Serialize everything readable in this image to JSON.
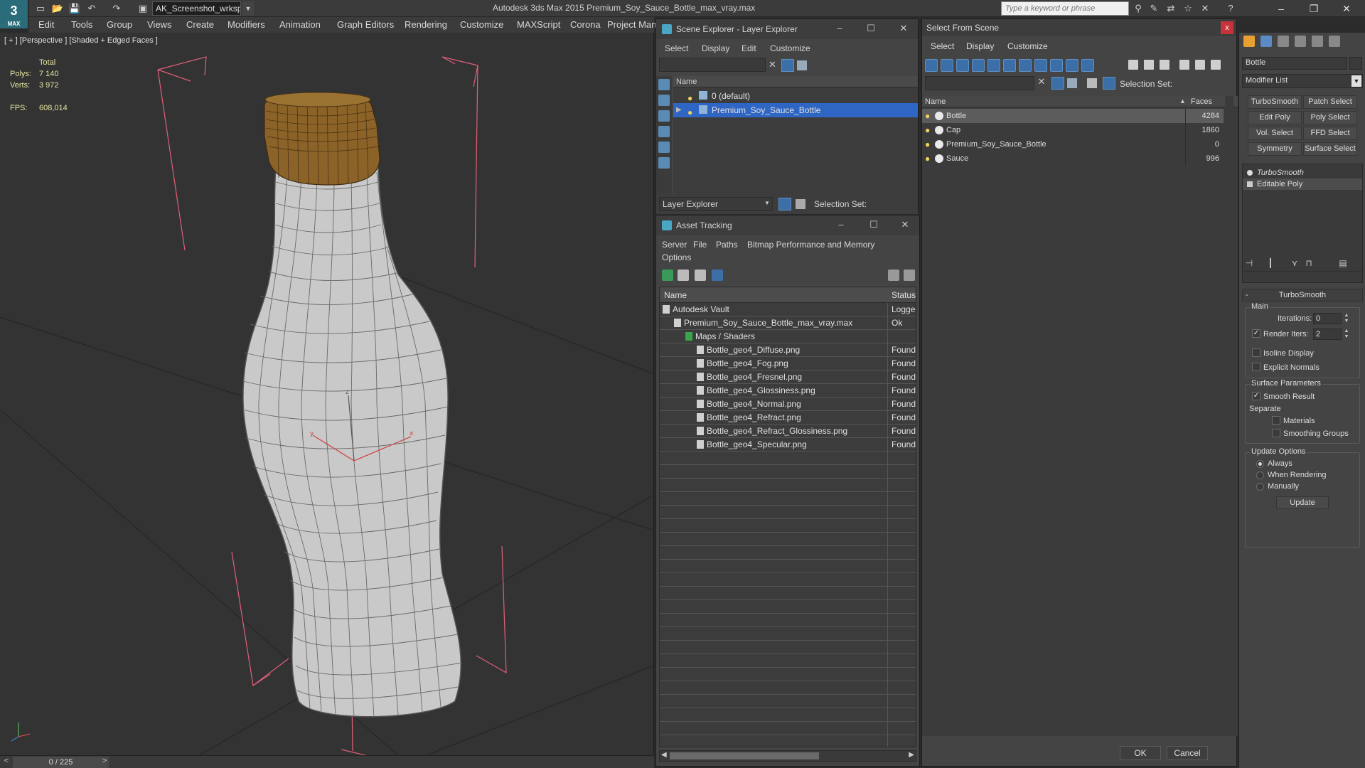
{
  "app": {
    "logo": "MAX",
    "title": "Autodesk 3ds Max  2015     Premium_Soy_Sauce_Bottle_max_vray.max",
    "workspace": "AK_Screenshot_wrksp",
    "search_placeholder": "Type a keyword or phrase",
    "quick_access_icons": [
      "new-file-icon",
      "open-file-icon",
      "save-icon",
      "undo-icon",
      "redo-icon",
      "project-folder-icon"
    ],
    "info_icons": [
      "binoculars-icon",
      "tools-icon",
      "exchange-icon",
      "star-icon",
      "close-x-icon",
      "help-icon"
    ]
  },
  "menu": [
    "Edit",
    "Tools",
    "Group",
    "Views",
    "Create",
    "Modifiers",
    "Animation",
    "Graph Editors",
    "Rendering",
    "Customize",
    "MAXScript",
    "Corona",
    "Project Man"
  ],
  "viewport": {
    "label": "[ + ] [Perspective ] [Shaded + Edged Faces ]",
    "stats": {
      "total_label": "Total",
      "polys_label": "Polys:",
      "polys_value": "7 140",
      "verts_label": "Verts:",
      "verts_value": "3 972",
      "fps_label": "FPS:",
      "fps_value": "608,014"
    },
    "gizmo_labels": {
      "z": "z",
      "y": "y",
      "x": "x"
    }
  },
  "timeline": {
    "position": "0 / 225",
    "prev": "<",
    "next": ">"
  },
  "scene_explorer": {
    "title": "Scene Explorer - Layer Explorer",
    "menus": [
      "Select",
      "Display",
      "Edit",
      "Customize"
    ],
    "column": "Name",
    "layers": [
      {
        "name": "0 (default)",
        "selected": false,
        "expandable": false
      },
      {
        "name": "Premium_Soy_Sauce_Bottle",
        "selected": true,
        "expandable": true
      }
    ],
    "mode": "Layer Explorer",
    "selection_set_label": "Selection Set:"
  },
  "asset_tracking": {
    "title": "Asset Tracking",
    "menus": [
      "Server",
      "File",
      "Paths",
      "Bitmap Performance and Memory",
      "Options"
    ],
    "columns": [
      "Name",
      "Status"
    ],
    "rows": [
      {
        "name": "Autodesk Vault",
        "status": "Logged",
        "level": 0
      },
      {
        "name": "Premium_Soy_Sauce_Bottle_max_vray.max",
        "status": "Ok",
        "level": 1
      },
      {
        "name": "Maps / Shaders",
        "status": "",
        "level": 2
      },
      {
        "name": "Bottle_geo4_Diffuse.png",
        "status": "Found",
        "level": 3
      },
      {
        "name": "Bottle_geo4_Fog.png",
        "status": "Found",
        "level": 3
      },
      {
        "name": "Bottle_geo4_Fresnel.png",
        "status": "Found",
        "level": 3
      },
      {
        "name": "Bottle_geo4_Glossiness.png",
        "status": "Found",
        "level": 3
      },
      {
        "name": "Bottle_geo4_Normal.png",
        "status": "Found",
        "level": 3
      },
      {
        "name": "Bottle_geo4_Refract.png",
        "status": "Found",
        "level": 3
      },
      {
        "name": "Bottle_geo4_Refract_Glossiness.png",
        "status": "Found",
        "level": 3
      },
      {
        "name": "Bottle_geo4_Specular.png",
        "status": "Found",
        "level": 3
      }
    ]
  },
  "select_from_scene": {
    "title": "Select From Scene",
    "close": "x",
    "menus": [
      "Select",
      "Display",
      "Customize"
    ],
    "selection_set_label": "Selection Set:",
    "columns": [
      "Name",
      "Faces"
    ],
    "objects": [
      {
        "name": "Bottle",
        "faces": "4284",
        "selected": true
      },
      {
        "name": "Cap",
        "faces": "1860",
        "selected": false
      },
      {
        "name": "Premium_Soy_Sauce_Bottle",
        "faces": "0",
        "selected": false
      },
      {
        "name": "Sauce",
        "faces": "996",
        "selected": false
      }
    ],
    "ok": "OK",
    "cancel": "Cancel"
  },
  "command_panel": {
    "object_name": "Bottle",
    "modifier_list": "Modifier List",
    "buttons": [
      "TurboSmooth",
      "Patch Select",
      "Edit Poly",
      "Poly Select",
      "Vol. Select",
      "FFD Select",
      "Symmetry",
      "Surface Select"
    ],
    "stack": [
      {
        "name": "TurboSmooth",
        "italic": true
      },
      {
        "name": "Editable Poly",
        "italic": false
      }
    ],
    "rollout_title": "TurboSmooth",
    "main_label": "Main",
    "iterations_label": "Iterations:",
    "iterations_value": "0",
    "render_iters_label": "Render Iters:",
    "render_iters_value": "2",
    "render_iters_checked": true,
    "isoline_label": "Isoline Display",
    "explicit_normals_label": "Explicit Normals",
    "surface_params_label": "Surface Parameters",
    "smooth_result_label": "Smooth Result",
    "separate_label": "Separate",
    "materials_label": "Materials",
    "smoothing_groups_label": "Smoothing Groups",
    "update_options_label": "Update Options",
    "always_label": "Always",
    "when_rendering_label": "When Rendering",
    "manually_label": "Manually",
    "update_button": "Update"
  },
  "colors": {
    "selection_blue": "#2f66c4",
    "stats_yellow": "#e6e6a0",
    "bounding_pink": "#e0607a",
    "cap_brown": "#8b6228",
    "mesh_gray": "#c9c9c9"
  }
}
